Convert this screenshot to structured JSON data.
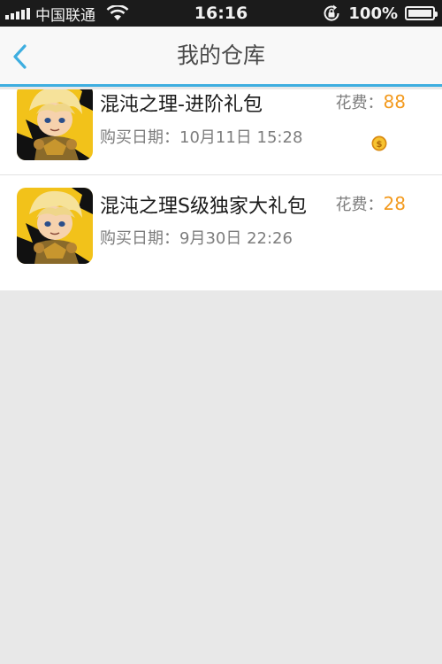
{
  "status_bar": {
    "carrier": "中国联通",
    "time": "16:16",
    "battery_percent": "100%",
    "battery_level": 1.0,
    "signal_bars": 5
  },
  "nav": {
    "title": "我的仓库",
    "back_icon": "chevron-left-icon"
  },
  "purchases": [
    {
      "title": "混沌之理-进阶礼包",
      "date_label": "购买日期：",
      "date": "10月11日 15:28",
      "cost_label": "花费：",
      "cost": "88",
      "coin_icon": "gold-coin-icon"
    },
    {
      "title": "混沌之理S级独家大礼包",
      "date_label": "购买日期：",
      "date": "9月30日 22:26",
      "cost_label": "花费：",
      "cost": "28"
    }
  ],
  "colors": {
    "accent": "#3eaee0",
    "cost": "#f39a1e",
    "status_bar": "#1b1b1b",
    "background": "#e8e8e8"
  }
}
